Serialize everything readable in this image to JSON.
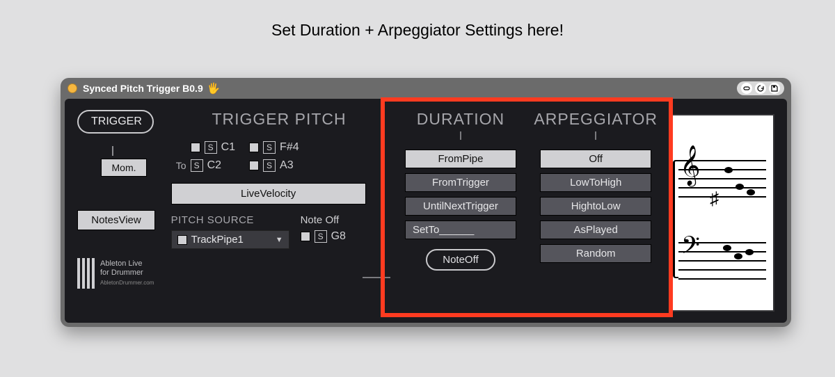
{
  "caption": "Set Duration + Arpeggiator Settings here!",
  "titlebar": {
    "title": "Synced Pitch Trigger B0.9"
  },
  "trigger": {
    "button_label": "TRIGGER",
    "mode_label": "Mom.",
    "notesview_label": "NotesView"
  },
  "logo": {
    "line1": "Ableton Live",
    "line2": "for Drummer",
    "sub": "AbletonDrummer.com"
  },
  "pitch": {
    "heading": "TRIGGER PITCH",
    "to_label": "To",
    "notes_left": [
      "C1",
      "C2"
    ],
    "notes_right": [
      "F#4",
      "A3"
    ],
    "live_velocity_label": "LiveVelocity",
    "source_heading": "PITCH SOURCE",
    "source_value": "TrackPipe1",
    "noteoff_heading": "Note Off",
    "noteoff_note": "G8",
    "s_label": "S"
  },
  "duration": {
    "heading": "DURATION",
    "options": [
      "FromPipe",
      "FromTrigger",
      "UntilNextTrigger",
      "SetTo______"
    ],
    "selected": 0,
    "noteoff_button": "NoteOff"
  },
  "arpeggiator": {
    "heading": "ARPEGGIATOR",
    "options": [
      "Off",
      "LowToHigh",
      "HightoLow",
      "AsPlayed",
      "Random"
    ],
    "selected": 0
  }
}
